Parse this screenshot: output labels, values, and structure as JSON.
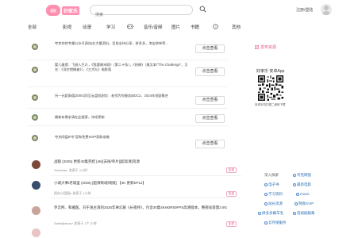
{
  "header": {
    "logo_text": "好家乐",
    "search_placeholder": "搜索",
    "login_label": "注册/登陆"
  },
  "nav": {
    "items": [
      "全部",
      "影视",
      "动漫",
      "学习",
      "音乐/音频",
      "图片",
      "书籍",
      "其他"
    ]
  },
  "feed": [
    {
      "text": "夸克你的专属公众号|网站在大量资料，目前支持分享，拼多多，淘宝拼单等…",
      "button": "点击查看"
    },
    {
      "text": "婴儿美食：飞驰人生2），《我要做宋刚》（第二十条），《热辣》（美文本/“The Challenge”，又名：《深空猎捕者》），《三大队》电影版",
      "button": "点击查看"
    },
    {
      "text": "另一元超高值|200G|同至云盘短剧包：老师为你服务|BDC2，2024年短剧集合",
      "button": "点击查看"
    },
    {
      "text": "最新有需求请在此搜索，持续更新",
      "button": "点击查看"
    },
    {
      "text": "夸克网盘8T扩容和免费SVIP获取攻略",
      "button": "点击查看"
    }
  ],
  "list": [
    {
      "title": "战狼 (2025) 更新40集完结 [4K][去除/单片][超高清]资源",
      "meta": "Yichenae.  发表于 1小时",
      "tag": "影视"
    },
    {
      "title": "小城大事/老城里 (2026) [超清晰/剧场版] 【4K 更新EP12】",
      "meta": "阳台小团团e  发表于 1小时",
      "tag": "影视"
    },
    {
      "title": "罗云熙、和雅医、刘于逸主演的2025年奇幻剧《长夜终》，包含30集4KHDR50FPS高清版本，整部总容量2.9G",
      "meta": "Saint@anus+  发表于 1个 小时",
      "tag": "影视"
    }
  ],
  "sidebar": {
    "publish": "发布资源",
    "app_title": "好家乐 安卓App",
    "qr_caption": "安卓手机扫描二维码下载",
    "tags": [
      "深入探索",
      "夸克网盘",
      "电子书",
      "最新电影",
      "学习资料",
      "music",
      "站长资源",
      "网盘SVIP",
      "拼多多薅羊毛",
      "电视剧剧集",
      "云存储服务"
    ]
  }
}
